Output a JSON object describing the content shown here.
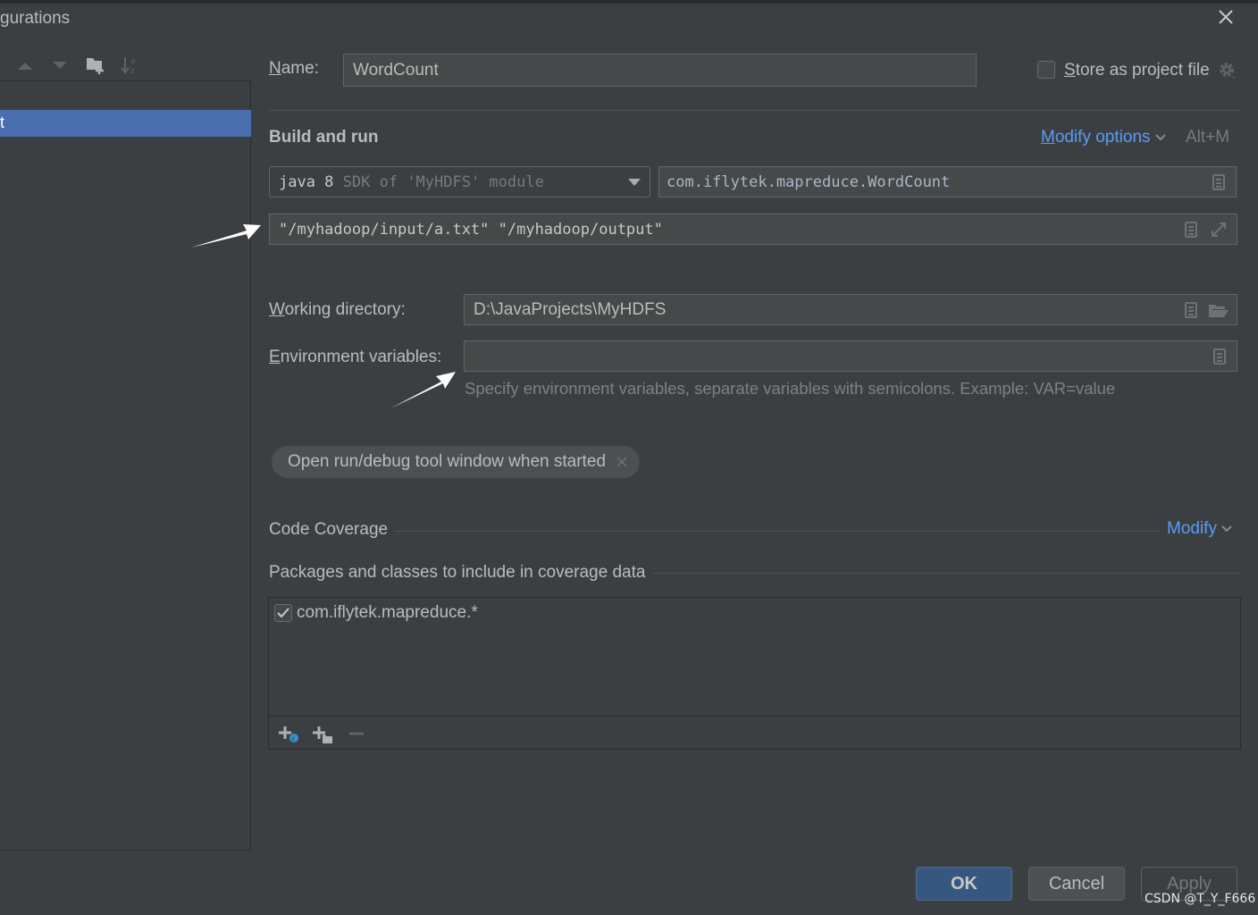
{
  "dialog": {
    "title": "gurations",
    "close_icon": "close-icon"
  },
  "toolbar": {
    "icons": [
      "move-up-icon",
      "move-down-icon",
      "new-folder-icon",
      "sort-alphabetically-icon"
    ]
  },
  "tree": {
    "selected_item": "t"
  },
  "form": {
    "name_label_u": "N",
    "name_label_rest": "ame:",
    "name_value": "WordCount",
    "store_checkbox_checked": false,
    "store_label_u": "S",
    "store_label_rest": "tore as project file",
    "section_build_run": "Build and run",
    "modify_options_u": "M",
    "modify_options_rest": "odify options",
    "modify_options_shortcut": "Alt+M",
    "jre_version": "java 8",
    "jre_hint": "SDK of 'MyHDFS' module",
    "main_class": "com.iflytek.mapreduce.WordCount",
    "program_args": "\"/myhadoop/input/a.txt\" \"/myhadoop/output\"",
    "working_dir_label_u": "W",
    "working_dir_label_rest": "orking directory:",
    "working_dir_value": "D:\\JavaProjects\\MyHDFS",
    "env_label_u": "E",
    "env_label_rest": "nvironment variables:",
    "env_value": "",
    "env_hint": "Specify environment variables, separate variables with semicolons. Example: VAR=value",
    "chip_label": "Open run/debug tool window when started",
    "code_coverage_label": "Code Coverage",
    "code_coverage_modify": "Modify",
    "packages_label": "Packages and classes to include in coverage data",
    "packages": [
      {
        "checked": true,
        "pattern": "com.iflytek.mapreduce.*"
      }
    ]
  },
  "buttons": {
    "ok": "OK",
    "cancel": "Cancel",
    "apply": "Apply"
  },
  "watermark": "CSDN @T_Y_F666",
  "colors": {
    "background": "#3c3f41",
    "selection": "#4b6eaf",
    "link": "#589df6",
    "ok_button": "#365880"
  }
}
